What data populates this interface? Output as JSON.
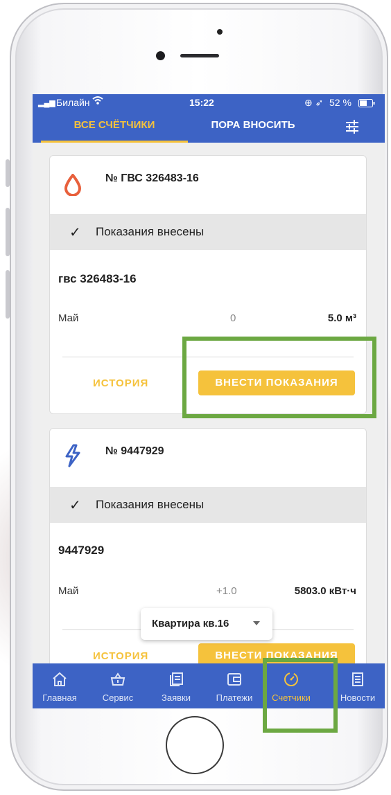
{
  "status_bar": {
    "carrier": "Билайн",
    "time": "15:22",
    "battery": "52 %"
  },
  "tabs": [
    {
      "label": "ВСЕ СЧЁТЧИКИ",
      "active": true
    },
    {
      "label": "ПОРА ВНОСИТЬ",
      "active": false
    }
  ],
  "filter_icon": "sliders-icon",
  "cards": [
    {
      "icon": "water-drop-icon",
      "title": "№ ГВС 326483-16",
      "status": "Показания внесены",
      "meter_name": "гвс 326483-16",
      "month": "Май",
      "delta": "0",
      "value": "5.0 м³",
      "history_label": "ИСТОРИЯ",
      "submit_label": "ВНЕСТИ ПОКАЗАНИЯ"
    },
    {
      "icon": "lightning-icon",
      "title": "№ 9447929",
      "status": "Показания внесены",
      "meter_name": "9447929",
      "month": "Май",
      "delta": "+1.0",
      "value": "5803.0 кВт·ч",
      "history_label": "ИСТОРИЯ",
      "submit_label": "ВНЕСТИ ПОКАЗАНИЯ"
    }
  ],
  "apartment_selector": {
    "label": "Квартира кв.16"
  },
  "bottom_nav": [
    {
      "label": "Главная",
      "icon": "home-icon"
    },
    {
      "label": "Сервис",
      "icon": "basket-icon"
    },
    {
      "label": "Заявки",
      "icon": "requests-icon"
    },
    {
      "label": "Платежи",
      "icon": "wallet-icon"
    },
    {
      "label": "Счетчики",
      "icon": "meter-icon",
      "active": true
    },
    {
      "label": "Новости",
      "icon": "news-icon"
    }
  ],
  "colors": {
    "primary": "#3d63c5",
    "accent": "#f5c23c",
    "highlight": "#6ca842",
    "drop": "#e8603c",
    "bolt": "#3d63c5"
  }
}
